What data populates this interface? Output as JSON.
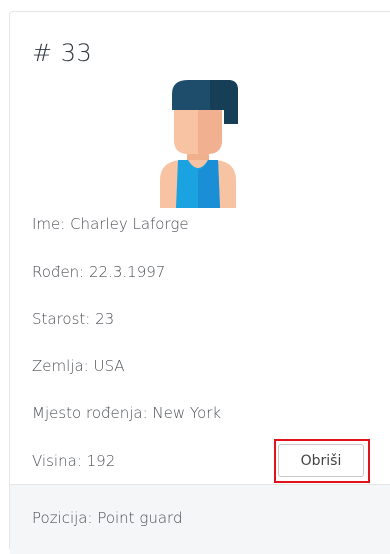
{
  "card": {
    "number": "# 33",
    "fields": {
      "ime": "Ime: Charley Laforge",
      "roden": "Rođen: 22.3.1997",
      "starost": "Starost: 23",
      "zemlja": "Zemlja: USA",
      "mjesto": "Mjesto rođenja: New York",
      "visina": "Visina: 192"
    },
    "delete_label": "Obriši",
    "footer": "Pozicija: Point guard",
    "avatar_icon": "basketball-player-icon",
    "highlight_color": "#e0121a"
  }
}
